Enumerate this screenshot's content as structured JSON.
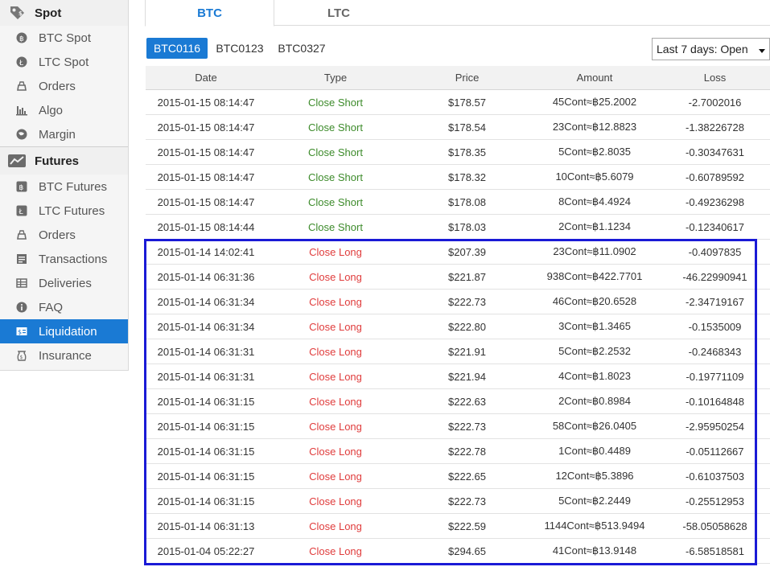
{
  "sidebar": {
    "spot_header": "Spot",
    "spot_items": [
      {
        "label": "BTC Spot",
        "icon": "btc-coin-icon"
      },
      {
        "label": "LTC Spot",
        "icon": "ltc-coin-icon"
      },
      {
        "label": "Orders",
        "icon": "orders-icon"
      },
      {
        "label": "Algo",
        "icon": "bar-chart-icon"
      },
      {
        "label": "Margin",
        "icon": "globe-icon"
      }
    ],
    "futures_header": "Futures",
    "futures_items": [
      {
        "label": "BTC Futures",
        "icon": "btc-futures-icon"
      },
      {
        "label": "LTC Futures",
        "icon": "ltc-futures-icon"
      },
      {
        "label": "Orders",
        "icon": "orders-icon"
      },
      {
        "label": "Transactions",
        "icon": "transactions-icon"
      },
      {
        "label": "Deliveries",
        "icon": "deliveries-icon"
      },
      {
        "label": "FAQ",
        "icon": "info-icon"
      },
      {
        "label": "Liquidation",
        "icon": "liquidation-icon",
        "active": true
      },
      {
        "label": "Insurance",
        "icon": "insurance-icon"
      }
    ]
  },
  "tabs": {
    "btc": "BTC",
    "ltc": "LTC"
  },
  "contracts": [
    "BTC0116",
    "BTC0123",
    "BTC0327"
  ],
  "filter": {
    "selected": "Last 7 days: Open"
  },
  "table": {
    "headers": {
      "date": "Date",
      "type": "Type",
      "price": "Price",
      "amount": "Amount",
      "loss": "Loss"
    },
    "rows": [
      {
        "date": "2015-01-15 08:14:47",
        "type": "Close Short",
        "price": "$178.57",
        "amount": "45Cont≈฿25.2002",
        "loss": "-2.7002016"
      },
      {
        "date": "2015-01-15 08:14:47",
        "type": "Close Short",
        "price": "$178.54",
        "amount": "23Cont≈฿12.8823",
        "loss": "-1.38226728"
      },
      {
        "date": "2015-01-15 08:14:47",
        "type": "Close Short",
        "price": "$178.35",
        "amount": "5Cont≈฿2.8035",
        "loss": "-0.30347631"
      },
      {
        "date": "2015-01-15 08:14:47",
        "type": "Close Short",
        "price": "$178.32",
        "amount": "10Cont≈฿5.6079",
        "loss": "-0.60789592"
      },
      {
        "date": "2015-01-15 08:14:47",
        "type": "Close Short",
        "price": "$178.08",
        "amount": "8Cont≈฿4.4924",
        "loss": "-0.49236298"
      },
      {
        "date": "2015-01-15 08:14:44",
        "type": "Close Short",
        "price": "$178.03",
        "amount": "2Cont≈฿1.1234",
        "loss": "-0.12340617"
      },
      {
        "date": "2015-01-14 14:02:41",
        "type": "Close Long",
        "price": "$207.39",
        "amount": "23Cont≈฿11.0902",
        "loss": "-0.4097835"
      },
      {
        "date": "2015-01-14 06:31:36",
        "type": "Close Long",
        "price": "$221.87",
        "amount": "938Cont≈฿422.7701",
        "loss": "-46.22990941"
      },
      {
        "date": "2015-01-14 06:31:34",
        "type": "Close Long",
        "price": "$222.73",
        "amount": "46Cont≈฿20.6528",
        "loss": "-2.34719167"
      },
      {
        "date": "2015-01-14 06:31:34",
        "type": "Close Long",
        "price": "$222.80",
        "amount": "3Cont≈฿1.3465",
        "loss": "-0.1535009"
      },
      {
        "date": "2015-01-14 06:31:31",
        "type": "Close Long",
        "price": "$221.91",
        "amount": "5Cont≈฿2.2532",
        "loss": "-0.2468343"
      },
      {
        "date": "2015-01-14 06:31:31",
        "type": "Close Long",
        "price": "$221.94",
        "amount": "4Cont≈฿1.8023",
        "loss": "-0.19771109"
      },
      {
        "date": "2015-01-14 06:31:15",
        "type": "Close Long",
        "price": "$222.63",
        "amount": "2Cont≈฿0.8984",
        "loss": "-0.10164848"
      },
      {
        "date": "2015-01-14 06:31:15",
        "type": "Close Long",
        "price": "$222.73",
        "amount": "58Cont≈฿26.0405",
        "loss": "-2.95950254"
      },
      {
        "date": "2015-01-14 06:31:15",
        "type": "Close Long",
        "price": "$222.78",
        "amount": "1Cont≈฿0.4489",
        "loss": "-0.05112667"
      },
      {
        "date": "2015-01-14 06:31:15",
        "type": "Close Long",
        "price": "$222.65",
        "amount": "12Cont≈฿5.3896",
        "loss": "-0.61037503"
      },
      {
        "date": "2015-01-14 06:31:15",
        "type": "Close Long",
        "price": "$222.73",
        "amount": "5Cont≈฿2.2449",
        "loss": "-0.25512953"
      },
      {
        "date": "2015-01-14 06:31:13",
        "type": "Close Long",
        "price": "$222.59",
        "amount": "1144Cont≈฿513.9494",
        "loss": "-58.05058628"
      },
      {
        "date": "2015-01-04 05:22:27",
        "type": "Close Long",
        "price": "$294.65",
        "amount": "41Cont≈฿13.9148",
        "loss": "-6.58518581"
      }
    ]
  },
  "colors": {
    "accent": "#1a7ad4",
    "short": "#3d8b2b",
    "long": "#e03c3c",
    "highlight_border": "#1a1ad6"
  }
}
